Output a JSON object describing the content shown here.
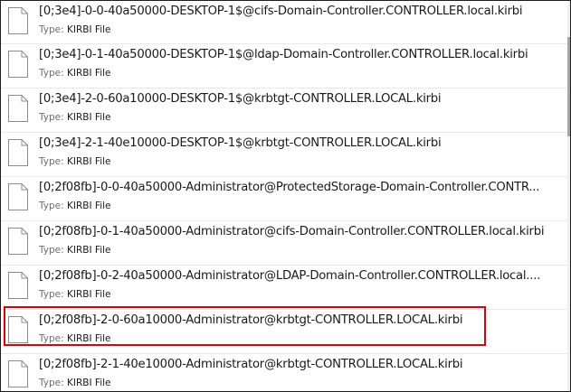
{
  "file_type_label": "Type:",
  "files": [
    {
      "name": "[0;3e4]-0-0-40a50000-DESKTOP-1$@cifs-Domain-Controller.CONTROLLER.local.kirbi",
      "type": "KIRBI File"
    },
    {
      "name": "[0;3e4]-0-1-40a50000-DESKTOP-1$@ldap-Domain-Controller.CONTROLLER.local.kirbi",
      "type": "KIRBI File"
    },
    {
      "name": "[0;3e4]-2-0-60a10000-DESKTOP-1$@krbtgt-CONTROLLER.LOCAL.kirbi",
      "type": "KIRBI File"
    },
    {
      "name": "[0;3e4]-2-1-40e10000-DESKTOP-1$@krbtgt-CONTROLLER.LOCAL.kirbi",
      "type": "KIRBI File"
    },
    {
      "name": "[0;2f08fb]-0-0-40a50000-Administrator@ProtectedStorage-Domain-Controller.CONTR...",
      "type": "KIRBI File"
    },
    {
      "name": "[0;2f08fb]-0-1-40a50000-Administrator@cifs-Domain-Controller.CONTROLLER.local.kirbi",
      "type": "KIRBI File"
    },
    {
      "name": "[0;2f08fb]-0-2-40a50000-Administrator@LDAP-Domain-Controller.CONTROLLER.local....",
      "type": "KIRBI File"
    },
    {
      "name": "[0;2f08fb]-2-0-60a10000-Administrator@krbtgt-CONTROLLER.LOCAL.kirbi",
      "type": "KIRBI File"
    },
    {
      "name": "[0;2f08fb]-2-1-40e10000-Administrator@krbtgt-CONTROLLER.LOCAL.kirbi",
      "type": "KIRBI File"
    }
  ],
  "highlighted_index": 7,
  "colors": {
    "highlight_border": "#e0000a",
    "separator": "#e9e9e9",
    "text": "#1a1a1a",
    "label_text": "#6d6d6d"
  },
  "icons": {
    "file": "document-file-icon"
  }
}
